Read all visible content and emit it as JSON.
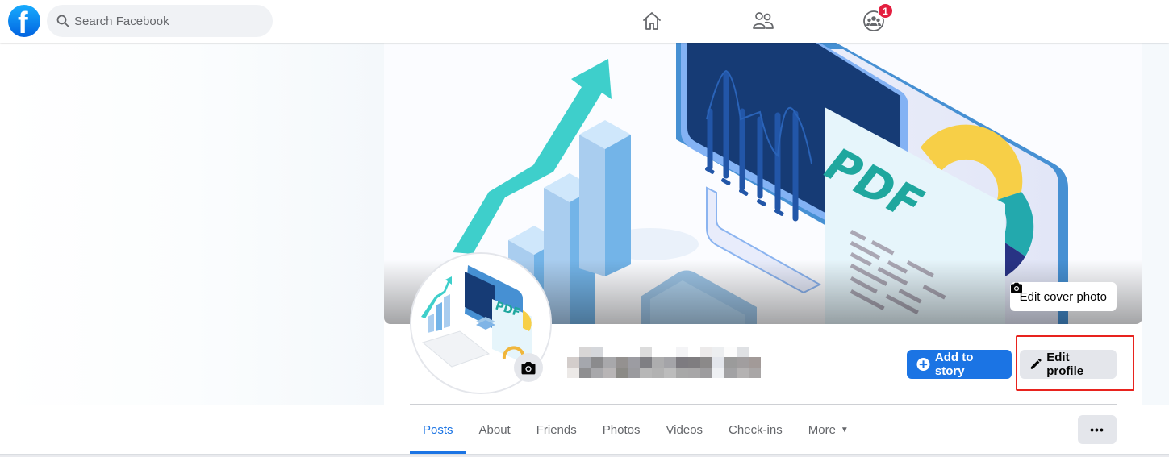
{
  "topbar": {
    "logo_letter": "f",
    "search_placeholder": "Search Facebook",
    "nav": [
      {
        "name": "home",
        "icon": "home-icon"
      },
      {
        "name": "friends",
        "icon": "friends-icon"
      },
      {
        "name": "groups",
        "icon": "groups-icon",
        "badge": "1"
      }
    ]
  },
  "cover": {
    "art_text": "PDF",
    "edit_cover_label": "Edit cover photo"
  },
  "profile": {
    "name_redacted": true,
    "add_story_label": "Add to story",
    "edit_profile_label": "Edit profile",
    "avatar_art_text": "PDF"
  },
  "tabs": [
    {
      "label": "Posts",
      "active": true
    },
    {
      "label": "About"
    },
    {
      "label": "Friends"
    },
    {
      "label": "Photos"
    },
    {
      "label": "Videos"
    },
    {
      "label": "Check-ins"
    },
    {
      "label": "More",
      "dropdown": true
    }
  ],
  "more_options_label": "•••",
  "colors": {
    "brand_blue": "#1b74e4",
    "badge_red": "#e41e3f",
    "highlight_red": "#e8231e",
    "teal": "#3ecfcb"
  }
}
